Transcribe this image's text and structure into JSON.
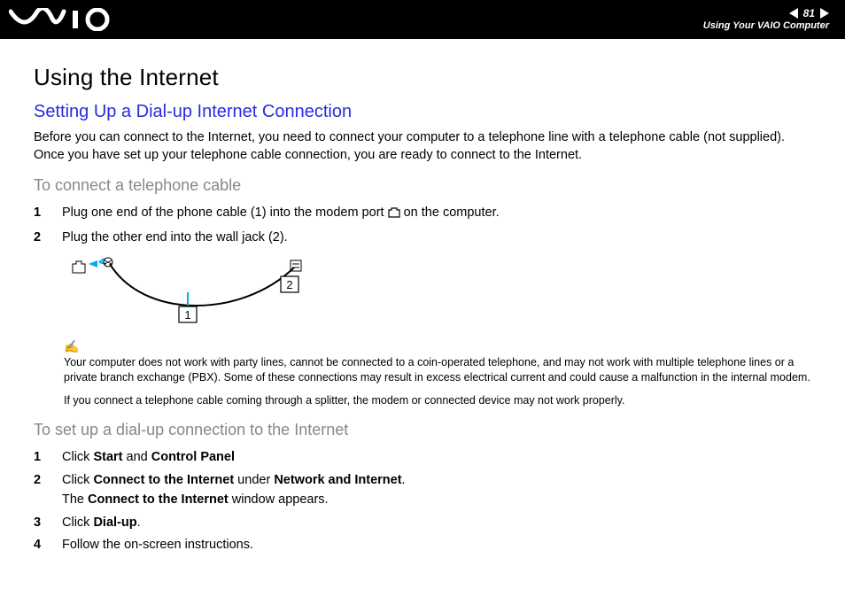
{
  "header": {
    "page_number": "81",
    "breadcrumb": "Using Your VAIO Computer"
  },
  "title": "Using the Internet",
  "section_title": "Setting Up a Dial-up Internet Connection",
  "intro": "Before you can connect to the Internet, you need to connect your computer to a telephone line with a telephone cable (not supplied). Once you have set up your telephone cable connection, you are ready to connect to the Internet.",
  "sub1_title": "To connect a telephone cable",
  "steps1": [
    {
      "n": "1",
      "pre": "Plug one end of the phone cable (1) into the modem port ",
      "post": " on the computer."
    },
    {
      "n": "2",
      "pre": "Plug the other end into the wall jack (2).",
      "post": ""
    }
  ],
  "diagram": {
    "label1": "1",
    "label2": "2"
  },
  "note1": "Your computer does not work with party lines, cannot be connected to a coin-operated telephone, and may not work with multiple telephone lines or a private branch exchange (PBX). Some of these connections may result in excess electrical current and could cause a malfunction in the internal modem.",
  "note2": "If you connect a telephone cable coming through a splitter, the modem or connected device may not work properly.",
  "sub2_title": "To set up a dial-up connection to the Internet",
  "steps2": [
    {
      "n": "1",
      "html": "Click <b>Start</b> and <b>Control Panel</b>"
    },
    {
      "n": "2",
      "html": "Click <b>Connect to the Internet</b> under <b>Network and Internet</b>.<br>The <b>Connect to the Internet</b> window appears."
    },
    {
      "n": "3",
      "html": "Click <b>Dial-up</b>."
    },
    {
      "n": "4",
      "html": "Follow the on-screen instructions."
    }
  ]
}
